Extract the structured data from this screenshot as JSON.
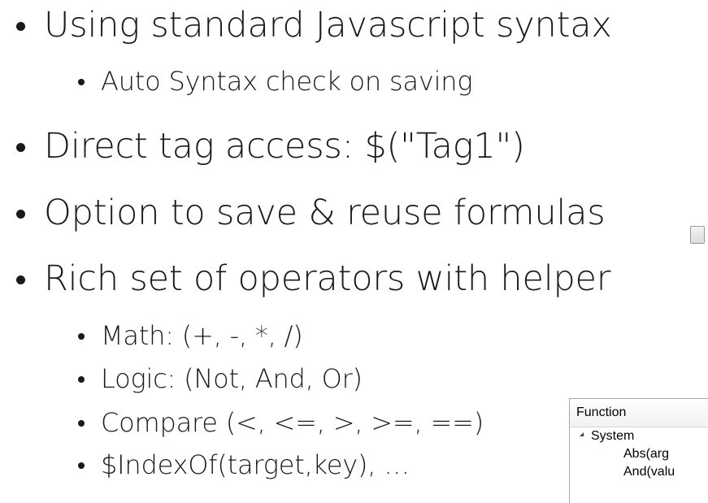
{
  "bullets": [
    {
      "level": 1,
      "text": "Using standard Javascript syntax"
    },
    {
      "level": 2,
      "text": "Auto Syntax check on saving"
    },
    {
      "level": 1,
      "text": "Direct tag access: $(\"Tag1\")"
    },
    {
      "level": 1,
      "text": "Option to save & reuse formulas"
    },
    {
      "level": 1,
      "text": "Rich set of operators with helper"
    },
    {
      "level": 2,
      "text": "Math: (+, -, *, /)"
    },
    {
      "level": 2,
      "text": "Logic: (Not, And, Or)"
    },
    {
      "level": 2,
      "text": "Compare (<, <=, >, >=, ==)"
    },
    {
      "level": 2,
      "text": "$IndexOf(target,key), …"
    }
  ],
  "function_panel": {
    "header": "Function",
    "group": "System",
    "items": [
      "Abs(arg",
      "And(valu"
    ]
  }
}
